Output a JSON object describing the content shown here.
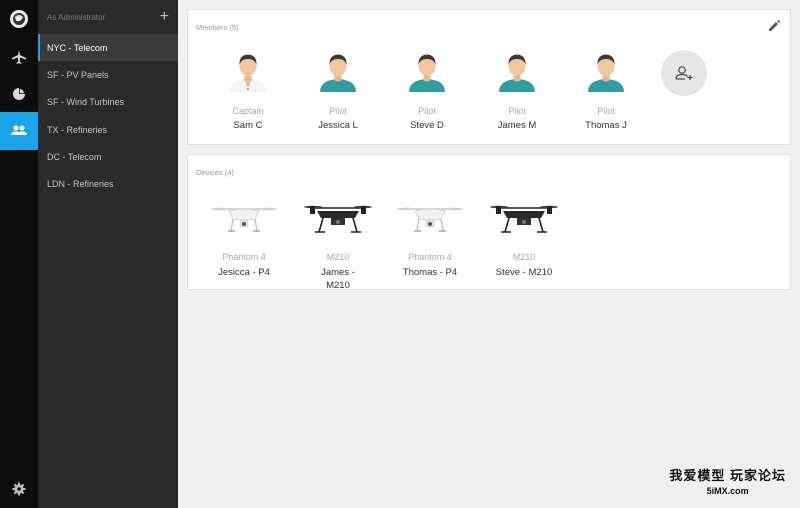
{
  "rail": {
    "items": [
      {
        "icon": "app-logo-icon"
      },
      {
        "icon": "airplane-icon"
      },
      {
        "icon": "pie-chart-icon"
      },
      {
        "icon": "team-icon",
        "active": true
      },
      {
        "icon": "gear-icon"
      }
    ],
    "accent": "#1aa3e8"
  },
  "sidebar": {
    "header": "As Administrator",
    "add_label": "+",
    "teams": [
      {
        "label": "NYC - Telecom",
        "active": true
      },
      {
        "label": "SF - PV Panels"
      },
      {
        "label": "SF - Wind Turbines"
      },
      {
        "label": "TX - Refineries"
      },
      {
        "label": "DC - Telecom"
      },
      {
        "label": "LDN - Refineries"
      }
    ]
  },
  "members": {
    "title": "Members (5)",
    "list": [
      {
        "role": "Captain",
        "name": "Sam C",
        "icon": "captain-avatar-icon"
      },
      {
        "role": "Pilot",
        "name": "Jessica L",
        "icon": "pilot-avatar-icon"
      },
      {
        "role": "Pilot",
        "name": "Steve D",
        "icon": "pilot-avatar-icon"
      },
      {
        "role": "Pilot",
        "name": "James M",
        "icon": "pilot-avatar-icon"
      },
      {
        "role": "Pilot",
        "name": "Thomas J",
        "icon": "pilot-avatar-icon"
      }
    ]
  },
  "devices": {
    "title": "Devices (4)",
    "list": [
      {
        "model": "Phantom 4",
        "name": "Jesicca - P4",
        "icon": "phantom-drone-icon"
      },
      {
        "model": "M210",
        "name": "James - M210",
        "icon": "m210-drone-icon"
      },
      {
        "model": "Phantom 4",
        "name": "Thomas - P4",
        "icon": "phantom-drone-icon"
      },
      {
        "model": "M210",
        "name": "Steve - M210",
        "icon": "m210-drone-icon"
      }
    ]
  },
  "watermark": {
    "line1": "我爱模型 玩家论坛",
    "line2": "5iMX.com"
  }
}
